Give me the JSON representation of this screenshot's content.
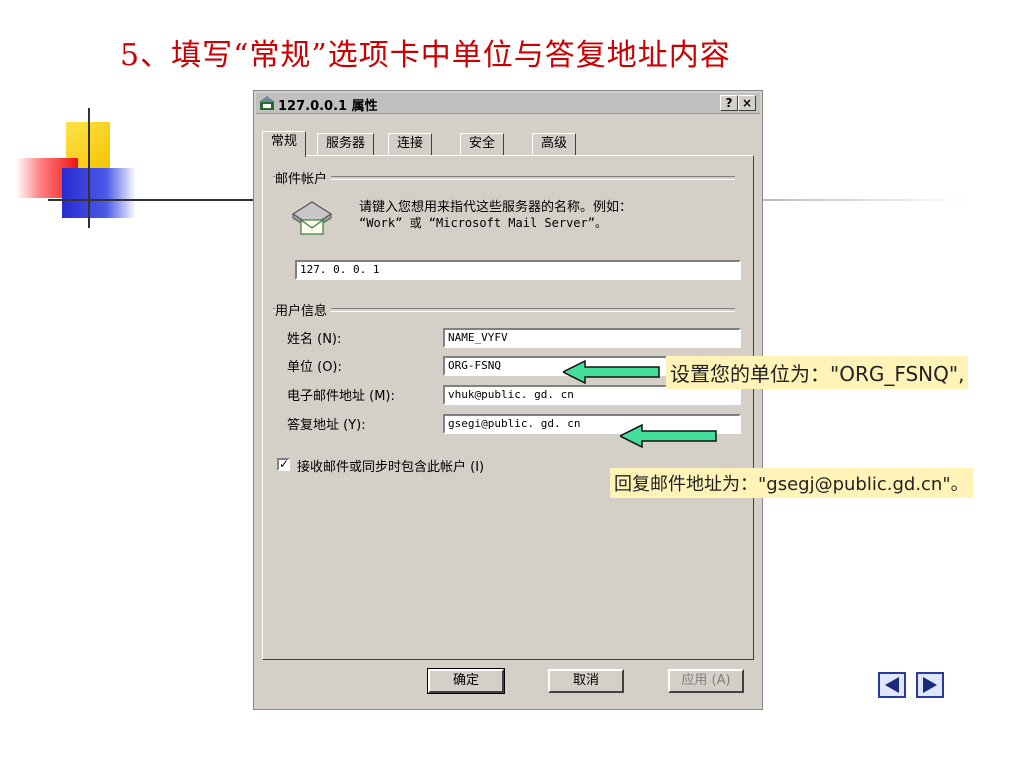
{
  "slide": {
    "title": "5、填写“常规”选项卡中单位与答复地址内容"
  },
  "dialog": {
    "title": "127.0.0.1 属性",
    "help_label": "?",
    "close_label": "×",
    "tabs": [
      {
        "label": "常规"
      },
      {
        "label": "服务器"
      },
      {
        "label": "连接"
      },
      {
        "label": "安全"
      },
      {
        "label": "高级"
      }
    ],
    "account_group": {
      "label": "邮件帐户",
      "description_line1": "请键入您想用来指代这些服务器的名称。例如：",
      "description_line2": "“Work” 或 “Microsoft Mail Server”。",
      "account_name": "127. 0. 0. 1",
      "icon": "mail-envelope-icon"
    },
    "user_group": {
      "label": "用户信息",
      "fields": [
        {
          "label": "姓名 (N):",
          "value": "NAME_VYFV"
        },
        {
          "label": "单位 (O):",
          "value": "ORG-FSNQ"
        },
        {
          "label": "电子邮件地址 (M):",
          "value": "vhuk@public. gd. cn"
        },
        {
          "label": "答复地址 (Y):",
          "value": "gsegi@public. gd. cn"
        }
      ]
    },
    "include_account": {
      "label": "接收邮件或同步时包含此帐户 (I)",
      "checked": true
    },
    "buttons": {
      "ok": "确定",
      "cancel": "取消",
      "apply": "应用 (A)"
    }
  },
  "annotations": {
    "org_note": "设置您的单位为：\"ORG_FSNQ\",",
    "reply_note": "回复邮件地址为：\"gsegj@public.gd.cn\"。",
    "arrow_color": "#33dd99"
  },
  "nav": {
    "prev_icon": "left-triangle-icon",
    "next_icon": "right-triangle-icon"
  }
}
